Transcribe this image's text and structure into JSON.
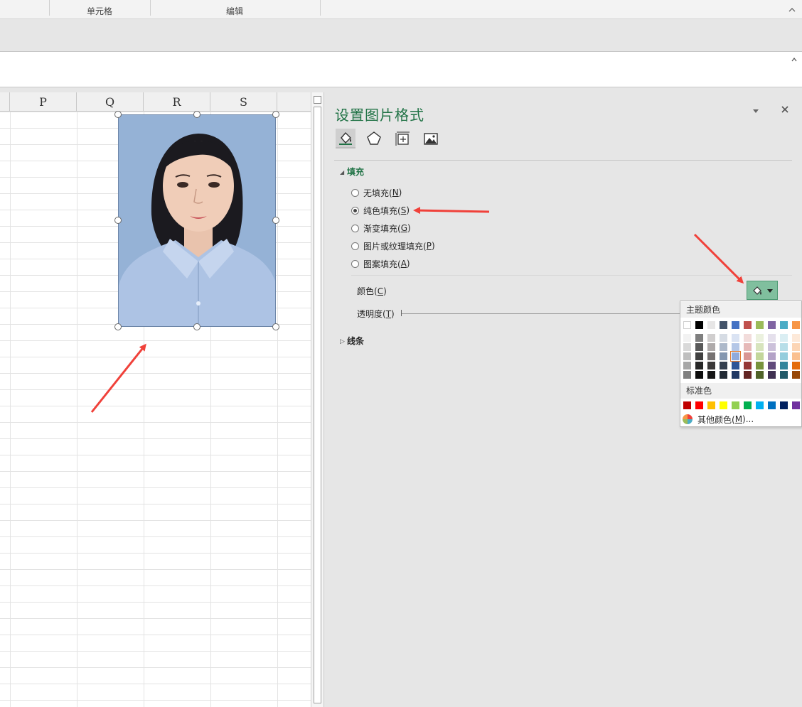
{
  "ribbon": {
    "groups": [
      "单元格",
      "编辑"
    ]
  },
  "sheet": {
    "columns": [
      "P",
      "Q",
      "R",
      "S"
    ]
  },
  "pane": {
    "title": "设置图片格式",
    "tabs": [
      "fill-line-icon",
      "effects-icon",
      "size-properties-icon",
      "picture-icon"
    ],
    "fill_section": "填充",
    "fill_options": [
      {
        "label": "无填充(",
        "key": "N",
        "checked": false
      },
      {
        "label": "纯色填充(",
        "key": "S",
        "checked": true
      },
      {
        "label": "渐变填充(",
        "key": "G",
        "checked": false
      },
      {
        "label": "图片或纹理填充(",
        "key": "P",
        "checked": false
      },
      {
        "label": "图案填充(",
        "key": "A",
        "checked": false
      }
    ],
    "color_label": "颜色(",
    "color_key": "C",
    "transparency_label": "透明度(",
    "transparency_key": "T",
    "line_section": "线条"
  },
  "color_popup": {
    "theme_title": "主题颜色",
    "standard_title": "标准色",
    "more_colors_label": "其他颜色(",
    "more_colors_key": "M",
    "more_colors_suffix": ")...",
    "theme_top": [
      "#FFFFFF",
      "#000000",
      "#E7E6E6",
      "#44546A",
      "#4472C4",
      "#C0504D",
      "#9BBB59",
      "#8064A2",
      "#4BACC6",
      "#F79646"
    ],
    "theme_shades": [
      [
        "#F2F2F2",
        "#7F7F7F",
        "#D0CECE",
        "#D6DCE4",
        "#DAE3F3",
        "#F2DCDB",
        "#EBF1DE",
        "#E5E0EC",
        "#DAEEF3",
        "#FDE9D9"
      ],
      [
        "#D9D9D9",
        "#595959",
        "#AEAAAA",
        "#ADB9CA",
        "#B4C7E7",
        "#E6B9B8",
        "#D7E4BD",
        "#CCC1DA",
        "#B7DEE8",
        "#FCD5B5"
      ],
      [
        "#BFBFBF",
        "#404040",
        "#757171",
        "#8497B0",
        "#8FAADC",
        "#D99694",
        "#C3D69B",
        "#B3A2C7",
        "#93CDDD",
        "#FAC090"
      ],
      [
        "#A6A6A6",
        "#262626",
        "#3A3838",
        "#333F50",
        "#2F5597",
        "#953735",
        "#77933C",
        "#604A7B",
        "#31859C",
        "#E46C0A"
      ],
      [
        "#808080",
        "#0D0D0D",
        "#161616",
        "#222A35",
        "#1F3864",
        "#632523",
        "#4F6228",
        "#403152",
        "#215968",
        "#984807"
      ]
    ],
    "selected": {
      "row": 2,
      "col": 4
    },
    "standard": [
      "#C00000",
      "#FF0000",
      "#FFC000",
      "#FFFF00",
      "#92D050",
      "#00B050",
      "#00B0F0",
      "#0070C0",
      "#002060",
      "#7030A0"
    ]
  },
  "colors": {
    "accent": "#217346",
    "arrow": "#F0413A",
    "color_button": "#80BF9E",
    "photo_bg": "#95B2D6"
  }
}
